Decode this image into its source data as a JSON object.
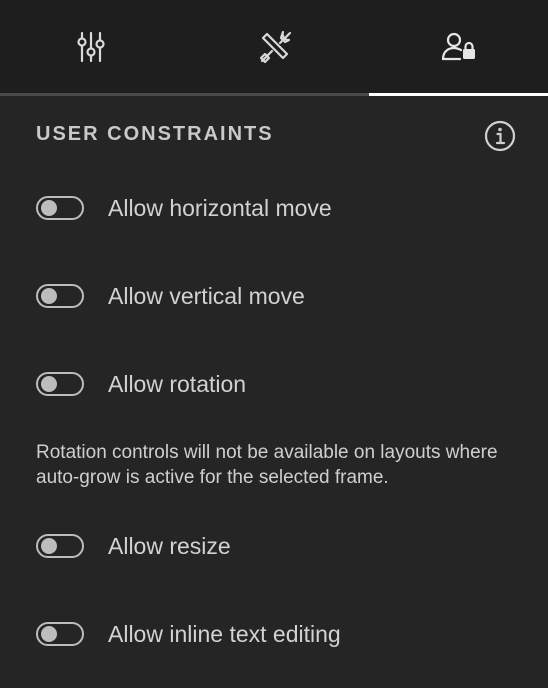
{
  "tabs": [
    {
      "name": "sliders-icon",
      "active": false
    },
    {
      "name": "tools-icon",
      "active": false
    },
    {
      "name": "user-lock-icon",
      "active": true
    }
  ],
  "section": {
    "title": "USER CONSTRAINTS",
    "info_icon": "info-icon"
  },
  "constraints": {
    "horizontal_move": {
      "label": "Allow horizontal move",
      "enabled": false
    },
    "vertical_move": {
      "label": "Allow vertical move",
      "enabled": false
    },
    "rotation": {
      "label": "Allow rotation",
      "enabled": false
    },
    "rotation_note": "Rotation controls will not be available on layouts where auto-grow is active for the selected frame.",
    "resize": {
      "label": "Allow resize",
      "enabled": false
    },
    "inline_text_editing": {
      "label": "Allow inline text editing",
      "enabled": false
    }
  },
  "colors": {
    "background": "#252525",
    "tabbar": "#1e1e1e",
    "active_tab_indicator": "#ffffff",
    "toggle_off": "#bdbdbd"
  }
}
